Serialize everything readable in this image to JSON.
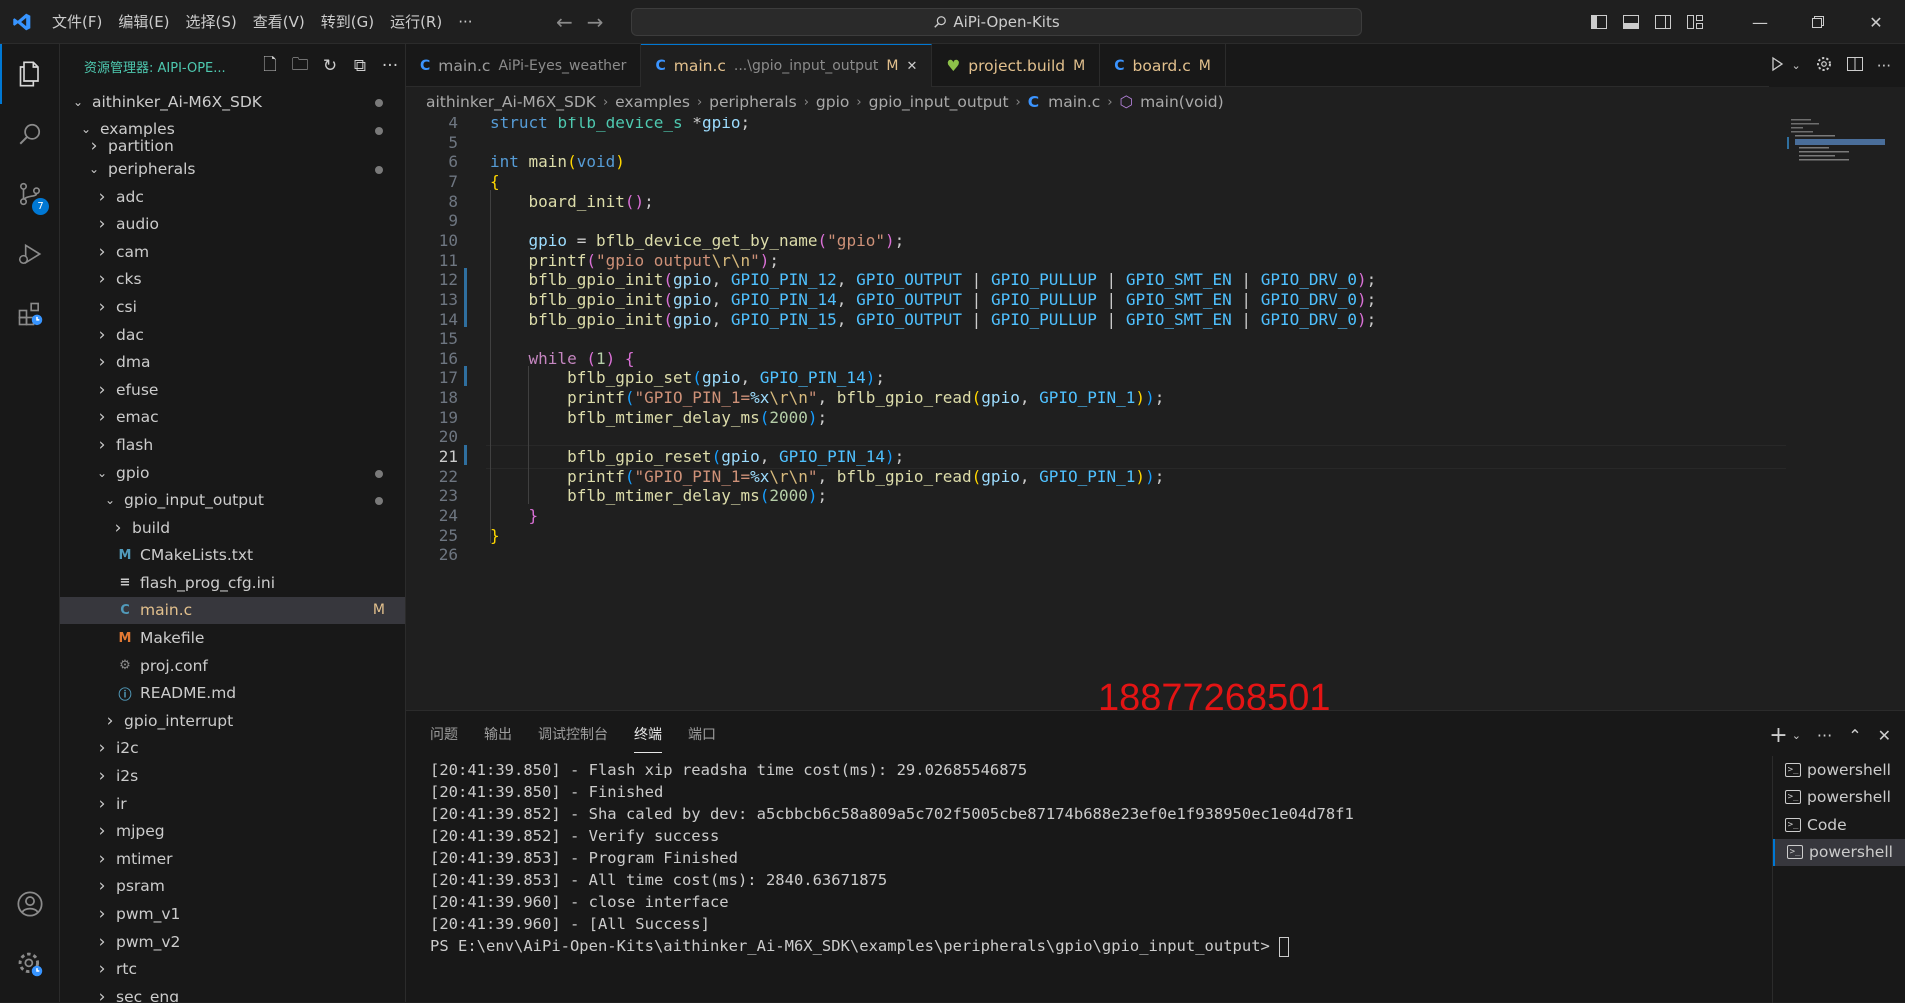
{
  "titlebar": {
    "menus": [
      "文件(F)",
      "编辑(E)",
      "选择(S)",
      "查看(V)",
      "转到(G)",
      "运行(R)",
      "···"
    ],
    "search_text": "AiPi-Open-Kits"
  },
  "activitybar": {
    "scm_badge": "7"
  },
  "sidebar": {
    "title": "资源管理器: AIPI-OPE...",
    "tree": [
      {
        "label": "aithinker_Ai-M6X_SDK",
        "depth": 0,
        "type": "folder-open",
        "dot": true
      },
      {
        "label": "examples",
        "depth": 1,
        "type": "folder-open",
        "dot": true
      },
      {
        "label": "partition",
        "depth": 2,
        "type": "folder",
        "partial": true
      },
      {
        "label": "peripherals",
        "depth": 2,
        "type": "folder-open",
        "dot": true
      },
      {
        "label": "adc",
        "depth": 3,
        "type": "folder"
      },
      {
        "label": "audio",
        "depth": 3,
        "type": "folder"
      },
      {
        "label": "cam",
        "depth": 3,
        "type": "folder"
      },
      {
        "label": "cks",
        "depth": 3,
        "type": "folder"
      },
      {
        "label": "csi",
        "depth": 3,
        "type": "folder"
      },
      {
        "label": "dac",
        "depth": 3,
        "type": "folder"
      },
      {
        "label": "dma",
        "depth": 3,
        "type": "folder"
      },
      {
        "label": "efuse",
        "depth": 3,
        "type": "folder"
      },
      {
        "label": "emac",
        "depth": 3,
        "type": "folder"
      },
      {
        "label": "flash",
        "depth": 3,
        "type": "folder"
      },
      {
        "label": "gpio",
        "depth": 3,
        "type": "folder-open",
        "dot": true
      },
      {
        "label": "gpio_input_output",
        "depth": 4,
        "type": "folder-open",
        "dot": true
      },
      {
        "label": "build",
        "depth": 5,
        "type": "folder"
      },
      {
        "label": "CMakeLists.txt",
        "depth": 5,
        "type": "file-cmake"
      },
      {
        "label": "flash_prog_cfg.ini",
        "depth": 5,
        "type": "file-ini"
      },
      {
        "label": "main.c",
        "depth": 5,
        "type": "file-c",
        "selected": true,
        "mod": "M"
      },
      {
        "label": "Makefile",
        "depth": 5,
        "type": "file-make"
      },
      {
        "label": "proj.conf",
        "depth": 5,
        "type": "file-conf"
      },
      {
        "label": "README.md",
        "depth": 5,
        "type": "file-md"
      },
      {
        "label": "gpio_interrupt",
        "depth": 4,
        "type": "folder"
      },
      {
        "label": "i2c",
        "depth": 3,
        "type": "folder"
      },
      {
        "label": "i2s",
        "depth": 3,
        "type": "folder"
      },
      {
        "label": "ir",
        "depth": 3,
        "type": "folder"
      },
      {
        "label": "mjpeg",
        "depth": 3,
        "type": "folder"
      },
      {
        "label": "mtimer",
        "depth": 3,
        "type": "folder"
      },
      {
        "label": "psram",
        "depth": 3,
        "type": "folder"
      },
      {
        "label": "pwm_v1",
        "depth": 3,
        "type": "folder"
      },
      {
        "label": "pwm_v2",
        "depth": 3,
        "type": "folder"
      },
      {
        "label": "rtc",
        "depth": 3,
        "type": "folder"
      },
      {
        "label": "sec_eng",
        "depth": 3,
        "type": "folder",
        "partial": true
      }
    ]
  },
  "tabs": [
    {
      "name": "main.c",
      "desc": "AiPi-Eyes_weather",
      "mod": "",
      "icon": "C",
      "active": false,
      "close": false
    },
    {
      "name": "main.c",
      "desc": "...\\gpio_input_output",
      "mod": "M",
      "icon": "C",
      "active": true,
      "close": true
    },
    {
      "name": "project.build",
      "desc": "",
      "mod": "M",
      "icon": "heart",
      "active": false,
      "close": false
    },
    {
      "name": "board.c",
      "desc": "",
      "mod": "M",
      "icon": "C",
      "active": false,
      "close": false
    }
  ],
  "breadcrumb": [
    "aithinker_Ai-M6X_SDK",
    "examples",
    "peripherals",
    "gpio",
    "gpio_input_output",
    "main.c",
    "main(void)"
  ],
  "editor": {
    "current_line": "21",
    "lines": [
      {
        "n": "4",
        "tokens": [
          [
            "k",
            "struct "
          ],
          [
            "t",
            "bflb_device_s "
          ],
          [
            "p",
            "*"
          ],
          [
            "v",
            "gpio"
          ],
          [
            "p",
            ";"
          ]
        ]
      },
      {
        "n": "5",
        "tokens": []
      },
      {
        "n": "6",
        "tokens": [
          [
            "k",
            "int "
          ],
          [
            "f",
            "main"
          ],
          [
            "br1",
            "("
          ],
          [
            "k",
            "void"
          ],
          [
            "br1",
            ")"
          ]
        ]
      },
      {
        "n": "7",
        "tokens": [
          [
            "br1",
            "{"
          ]
        ]
      },
      {
        "n": "8",
        "tokens": [
          [
            "p",
            "    "
          ],
          [
            "f",
            "board_init"
          ],
          [
            "br2",
            "()"
          ],
          [
            "p",
            ";"
          ]
        ]
      },
      {
        "n": "9",
        "tokens": []
      },
      {
        "n": "10",
        "tokens": [
          [
            "p",
            "    "
          ],
          [
            "v",
            "gpio"
          ],
          [
            "p",
            " = "
          ],
          [
            "f",
            "bflb_device_get_by_name"
          ],
          [
            "br2",
            "("
          ],
          [
            "s",
            "\"gpio\""
          ],
          [
            "br2",
            ")"
          ],
          [
            "p",
            ";"
          ]
        ]
      },
      {
        "n": "11",
        "tokens": [
          [
            "p",
            "    "
          ],
          [
            "f",
            "printf"
          ],
          [
            "br2",
            "("
          ],
          [
            "s",
            "\"gpio output"
          ],
          [
            "esc",
            "\\r\\n"
          ],
          [
            "s",
            "\""
          ],
          [
            "br2",
            ")"
          ],
          [
            "p",
            ";"
          ]
        ]
      },
      {
        "n": "12",
        "tokens": [
          [
            "p",
            "    "
          ],
          [
            "f",
            "bflb_gpio_init"
          ],
          [
            "br2",
            "("
          ],
          [
            "v",
            "gpio"
          ],
          [
            "p",
            ", "
          ],
          [
            "c",
            "GPIO_PIN_12"
          ],
          [
            "p",
            ", "
          ],
          [
            "c",
            "GPIO_OUTPUT"
          ],
          [
            "p",
            " | "
          ],
          [
            "c",
            "GPIO_PULLUP"
          ],
          [
            "p",
            " | "
          ],
          [
            "c",
            "GPIO_SMT_EN"
          ],
          [
            "p",
            " | "
          ],
          [
            "c",
            "GPIO_DRV_0"
          ],
          [
            "br2",
            ")"
          ],
          [
            "p",
            ";"
          ]
        ]
      },
      {
        "n": "13",
        "tokens": [
          [
            "p",
            "    "
          ],
          [
            "f",
            "bflb_gpio_init"
          ],
          [
            "br2",
            "("
          ],
          [
            "v",
            "gpio"
          ],
          [
            "p",
            ", "
          ],
          [
            "c",
            "GPIO_PIN_14"
          ],
          [
            "p",
            ", "
          ],
          [
            "c",
            "GPIO_OUTPUT"
          ],
          [
            "p",
            " | "
          ],
          [
            "c",
            "GPIO_PULLUP"
          ],
          [
            "p",
            " | "
          ],
          [
            "c",
            "GPIO_SMT_EN"
          ],
          [
            "p",
            " | "
          ],
          [
            "c",
            "GPIO_DRV_0"
          ],
          [
            "br2",
            ")"
          ],
          [
            "p",
            ";"
          ]
        ]
      },
      {
        "n": "14",
        "tokens": [
          [
            "p",
            "    "
          ],
          [
            "f",
            "bflb_gpio_init"
          ],
          [
            "br2",
            "("
          ],
          [
            "v",
            "gpio"
          ],
          [
            "p",
            ", "
          ],
          [
            "c",
            "GPIO_PIN_15"
          ],
          [
            "p",
            ", "
          ],
          [
            "c",
            "GPIO_OUTPUT"
          ],
          [
            "p",
            " | "
          ],
          [
            "c",
            "GPIO_PULLUP"
          ],
          [
            "p",
            " | "
          ],
          [
            "c",
            "GPIO_SMT_EN"
          ],
          [
            "p",
            " | "
          ],
          [
            "c",
            "GPIO_DRV_0"
          ],
          [
            "br2",
            ")"
          ],
          [
            "p",
            ";"
          ]
        ]
      },
      {
        "n": "15",
        "tokens": []
      },
      {
        "n": "16",
        "tokens": [
          [
            "p",
            "    "
          ],
          [
            "kw2",
            "while "
          ],
          [
            "br2",
            "("
          ],
          [
            "n",
            "1"
          ],
          [
            "br2",
            ") {"
          ]
        ]
      },
      {
        "n": "17",
        "tokens": [
          [
            "p",
            "        "
          ],
          [
            "f",
            "bflb_gpio_set"
          ],
          [
            "br3",
            "("
          ],
          [
            "v",
            "gpio"
          ],
          [
            "p",
            ", "
          ],
          [
            "c",
            "GPIO_PIN_14"
          ],
          [
            "br3",
            ")"
          ],
          [
            "p",
            ";"
          ]
        ]
      },
      {
        "n": "18",
        "tokens": [
          [
            "p",
            "        "
          ],
          [
            "f",
            "printf"
          ],
          [
            "br3",
            "("
          ],
          [
            "s",
            "\"GPIO_PIN_1="
          ],
          [
            "v",
            "%x"
          ],
          [
            "esc",
            "\\r\\n"
          ],
          [
            "s",
            "\""
          ],
          [
            "p",
            ", "
          ],
          [
            "f",
            "bflb_gpio_read"
          ],
          [
            "br1",
            "("
          ],
          [
            "v",
            "gpio"
          ],
          [
            "p",
            ", "
          ],
          [
            "c",
            "GPIO_PIN_1"
          ],
          [
            "br1",
            ")"
          ],
          [
            "br3",
            ")"
          ],
          [
            "p",
            ";"
          ]
        ]
      },
      {
        "n": "19",
        "tokens": [
          [
            "p",
            "        "
          ],
          [
            "f",
            "bflb_mtimer_delay_ms"
          ],
          [
            "br3",
            "("
          ],
          [
            "n",
            "2000"
          ],
          [
            "br3",
            ")"
          ],
          [
            "p",
            ";"
          ]
        ]
      },
      {
        "n": "20",
        "tokens": []
      },
      {
        "n": "21",
        "tokens": [
          [
            "p",
            "        "
          ],
          [
            "f",
            "bflb_gpio_reset"
          ],
          [
            "br3",
            "("
          ],
          [
            "v",
            "gpio"
          ],
          [
            "p",
            ", "
          ],
          [
            "c",
            "GPIO_PIN_14"
          ],
          [
            "br3",
            ")"
          ],
          [
            "p",
            ";"
          ]
        ]
      },
      {
        "n": "22",
        "tokens": [
          [
            "p",
            "        "
          ],
          [
            "f",
            "printf"
          ],
          [
            "br3",
            "("
          ],
          [
            "s",
            "\"GPIO_PIN_1="
          ],
          [
            "v",
            "%x"
          ],
          [
            "esc",
            "\\r\\n"
          ],
          [
            "s",
            "\""
          ],
          [
            "p",
            ", "
          ],
          [
            "f",
            "bflb_gpio_read"
          ],
          [
            "br1",
            "("
          ],
          [
            "v",
            "gpio"
          ],
          [
            "p",
            ", "
          ],
          [
            "c",
            "GPIO_PIN_1"
          ],
          [
            "br1",
            ")"
          ],
          [
            "br3",
            ")"
          ],
          [
            "p",
            ";"
          ]
        ]
      },
      {
        "n": "23",
        "tokens": [
          [
            "p",
            "        "
          ],
          [
            "f",
            "bflb_mtimer_delay_ms"
          ],
          [
            "br3",
            "("
          ],
          [
            "n",
            "2000"
          ],
          [
            "br3",
            ")"
          ],
          [
            "p",
            ";"
          ]
        ]
      },
      {
        "n": "24",
        "tokens": [
          [
            "p",
            "    "
          ],
          [
            "br2",
            "}"
          ]
        ]
      },
      {
        "n": "25",
        "tokens": [
          [
            "br1",
            "}"
          ]
        ]
      },
      {
        "n": "26",
        "tokens": []
      }
    ]
  },
  "watermark": "18877268501",
  "panel": {
    "tabs": [
      "问题",
      "输出",
      "调试控制台",
      "终端",
      "端口"
    ],
    "active_tab": "终端",
    "terminal_lines": [
      "[20:41:39.850] - Flash xip readsha time cost(ms): 29.02685546875",
      "[20:41:39.850] - Finished",
      "[20:41:39.852] - Sha caled by dev: a5cbbcb6c58a809a5c702f5005cbe87174b688e23ef0e1f938950ec1e04d78f1",
      "[20:41:39.852] - Verify success",
      "[20:41:39.853] - Program Finished",
      "[20:41:39.853] - All time cost(ms): 2840.63671875",
      "[20:41:39.960] - close interface",
      "[20:41:39.960] - [All Success]"
    ],
    "prompt": "PS E:\\env\\AiPi-Open-Kits\\aithinker_Ai-M6X_SDK\\examples\\peripherals\\gpio\\gpio_input_output> ",
    "terminals": [
      "powershell",
      "powershell",
      "Code",
      "powershell"
    ],
    "active_terminal": 3
  },
  "colors": {
    "accent": "#0078d4",
    "modified": "#e2c08d",
    "watermark": "#e31414"
  }
}
